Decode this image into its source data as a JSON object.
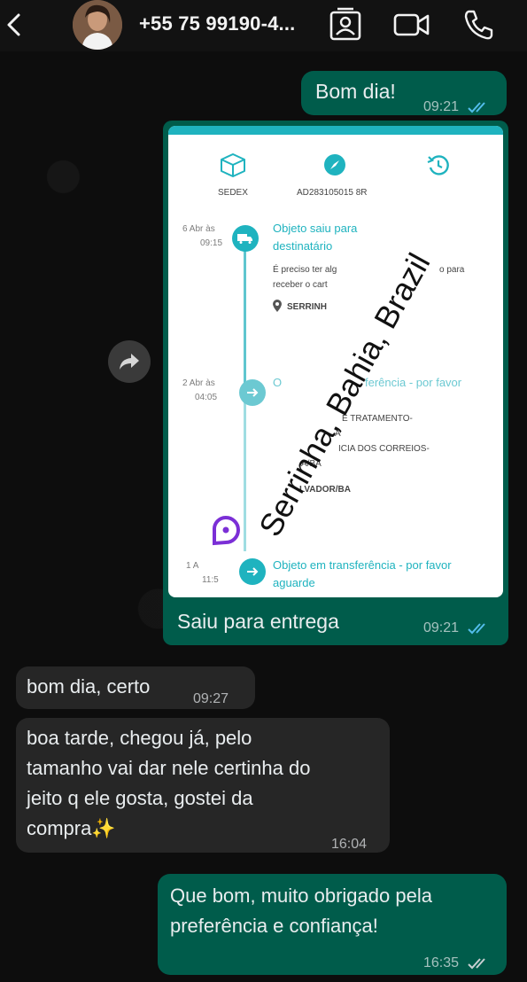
{
  "header": {
    "contact_name": "+55 75 99190-4...",
    "icons": [
      "back-arrow-icon",
      "contact-card-icon",
      "video-call-icon",
      "phone-icon"
    ]
  },
  "messages": [
    {
      "id": "m1",
      "direction": "outgoing",
      "text": "Bom dia!",
      "time": "09:21",
      "status": "read"
    },
    {
      "id": "m2",
      "direction": "outgoing",
      "type": "image",
      "caption": "Saiu para entrega",
      "time": "09:21",
      "status": "read",
      "image": {
        "service": "SEDEX",
        "tracking_code": "AD283105015 8R",
        "watermark": "Serrinha, Bahia, Brazil",
        "events": [
          {
            "date": "6 Abr às",
            "hour": "09:15",
            "title_l1": "Objeto saiu para",
            "title_l2": "destinatário",
            "desc_l1": "É preciso ter alg",
            "desc_l1b": "o para",
            "desc_l2": "receber o cart",
            "location": "SERRINH"
          },
          {
            "date": "2 Abr às",
            "hour": "04:05",
            "title_l1": "O",
            "title_l1b": "ferência - por favor",
            "desc_l1": "E TRATAMENTO-",
            "desc_l2": "A",
            "desc_l3": "ICIA DOS CORREIOS-",
            "desc_l4": "A/BA",
            "location": "LVADOR/BA"
          },
          {
            "date": "1 A",
            "hour": "11:5",
            "title_l1": "Objeto em transferência - por favor",
            "title_l2": "aguarde"
          }
        ]
      }
    },
    {
      "id": "m3",
      "direction": "incoming",
      "text": "bom dia, certo",
      "time": "09:27"
    },
    {
      "id": "m4",
      "direction": "incoming",
      "lines": [
        "boa tarde, chegou já, pelo",
        "tamanho vai dar nele certinha do",
        "jeito q ele gosta, gostei da",
        "compra✨"
      ],
      "time": "16:04"
    },
    {
      "id": "m5",
      "direction": "outgoing",
      "lines": [
        "Que bom, muito obrigado pela",
        "preferência e confiança!"
      ],
      "time": "16:35",
      "status": "delivered"
    }
  ],
  "colors": {
    "outgoing": "#005c4b",
    "incoming": "#262626",
    "accent": "#1fb3bf",
    "read_ticks": "#53bdeb"
  }
}
